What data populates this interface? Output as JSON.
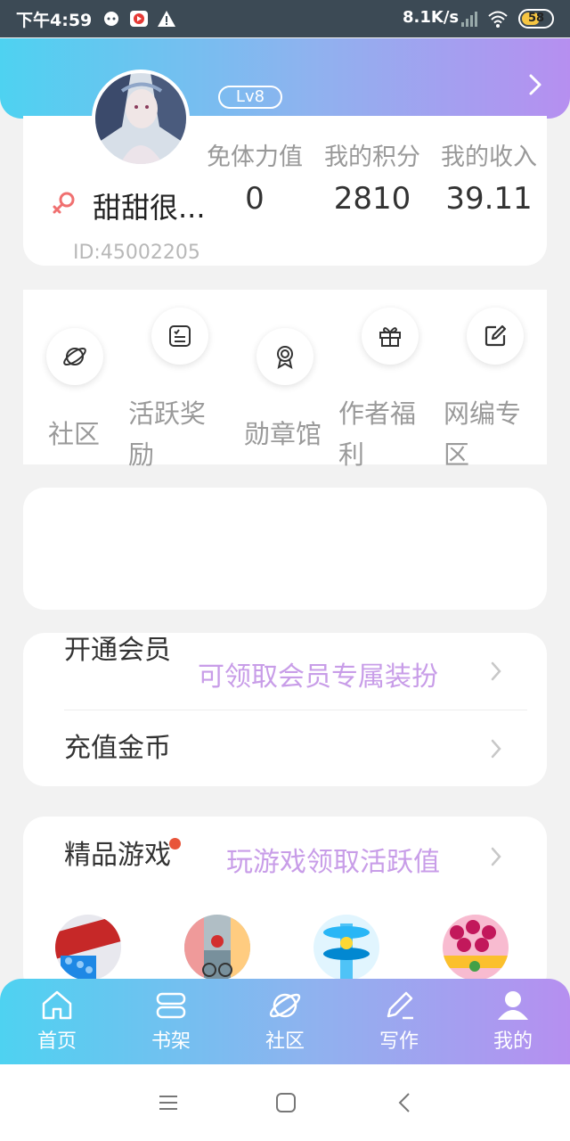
{
  "status_bar": {
    "time": "下午4:59",
    "net_speed": "8.1K/s",
    "battery": "58"
  },
  "profile": {
    "level": "Lv8",
    "username": "甜甜很...",
    "user_id": "ID:45002205",
    "stats": [
      {
        "label": "免体力值",
        "value": "0"
      },
      {
        "label": "我的积分",
        "value": "2810"
      },
      {
        "label": "我的收入",
        "value": "39.11"
      }
    ]
  },
  "quick_menu": [
    {
      "label": "社区",
      "icon": "planet-icon"
    },
    {
      "label": "活跃奖励",
      "icon": "checklist-icon"
    },
    {
      "label": "勋章馆",
      "icon": "medal-icon"
    },
    {
      "label": "作者福利",
      "icon": "gift-icon"
    },
    {
      "label": "网编专区",
      "icon": "edit-icon"
    }
  ],
  "member": {
    "vip_title": "开通会员",
    "vip_promo": "可领取会员专属装扮",
    "recharge_title": "充值金币"
  },
  "games": {
    "title": "精品游戏",
    "promo": "玩游戏领取活跃值"
  },
  "bottom_nav": [
    {
      "label": "首页",
      "icon": "home-icon"
    },
    {
      "label": "书架",
      "icon": "bookshelf-icon"
    },
    {
      "label": "社区",
      "icon": "planet-icon"
    },
    {
      "label": "写作",
      "icon": "pen-icon"
    },
    {
      "label": "我的",
      "icon": "user-icon"
    }
  ],
  "colors": {
    "gradient_start": "#4ed2f1",
    "gradient_end": "#b68ff0",
    "promo_purple": "#c89de8",
    "badge_red": "#e8553a"
  }
}
